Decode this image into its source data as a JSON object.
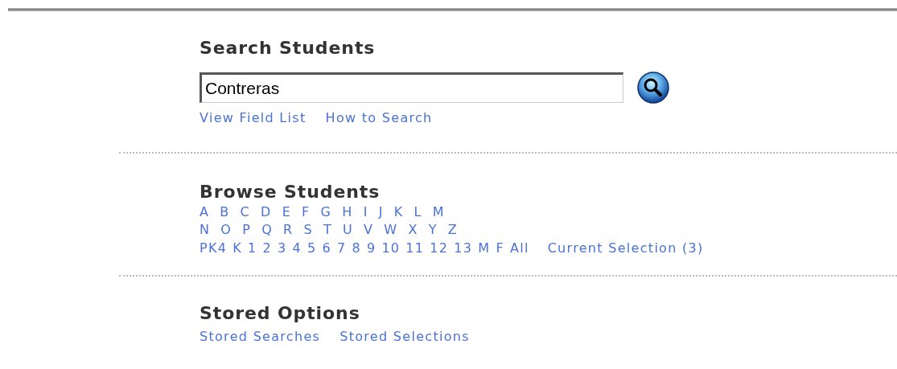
{
  "search": {
    "title": "Search Students",
    "value": "Contreras",
    "links": [
      "View Field List",
      "How to Search"
    ]
  },
  "browse": {
    "title": "Browse Students",
    "letters": [
      "A",
      "B",
      "C",
      "D",
      "E",
      "F",
      "G",
      "H",
      "I",
      "J",
      "K",
      "L",
      "M",
      "N",
      "O",
      "P",
      "Q",
      "R",
      "S",
      "T",
      "U",
      "V",
      "W",
      "X",
      "Y",
      "Z"
    ],
    "grades": [
      "PK4",
      "K",
      "1",
      "2",
      "3",
      "4",
      "5",
      "6",
      "7",
      "8",
      "9",
      "10",
      "11",
      "12",
      "13",
      "M",
      "F",
      "All"
    ],
    "current_selection": "Current Selection (3)"
  },
  "stored": {
    "title": "Stored Options",
    "links": [
      "Stored Searches",
      "Stored Selections"
    ]
  }
}
